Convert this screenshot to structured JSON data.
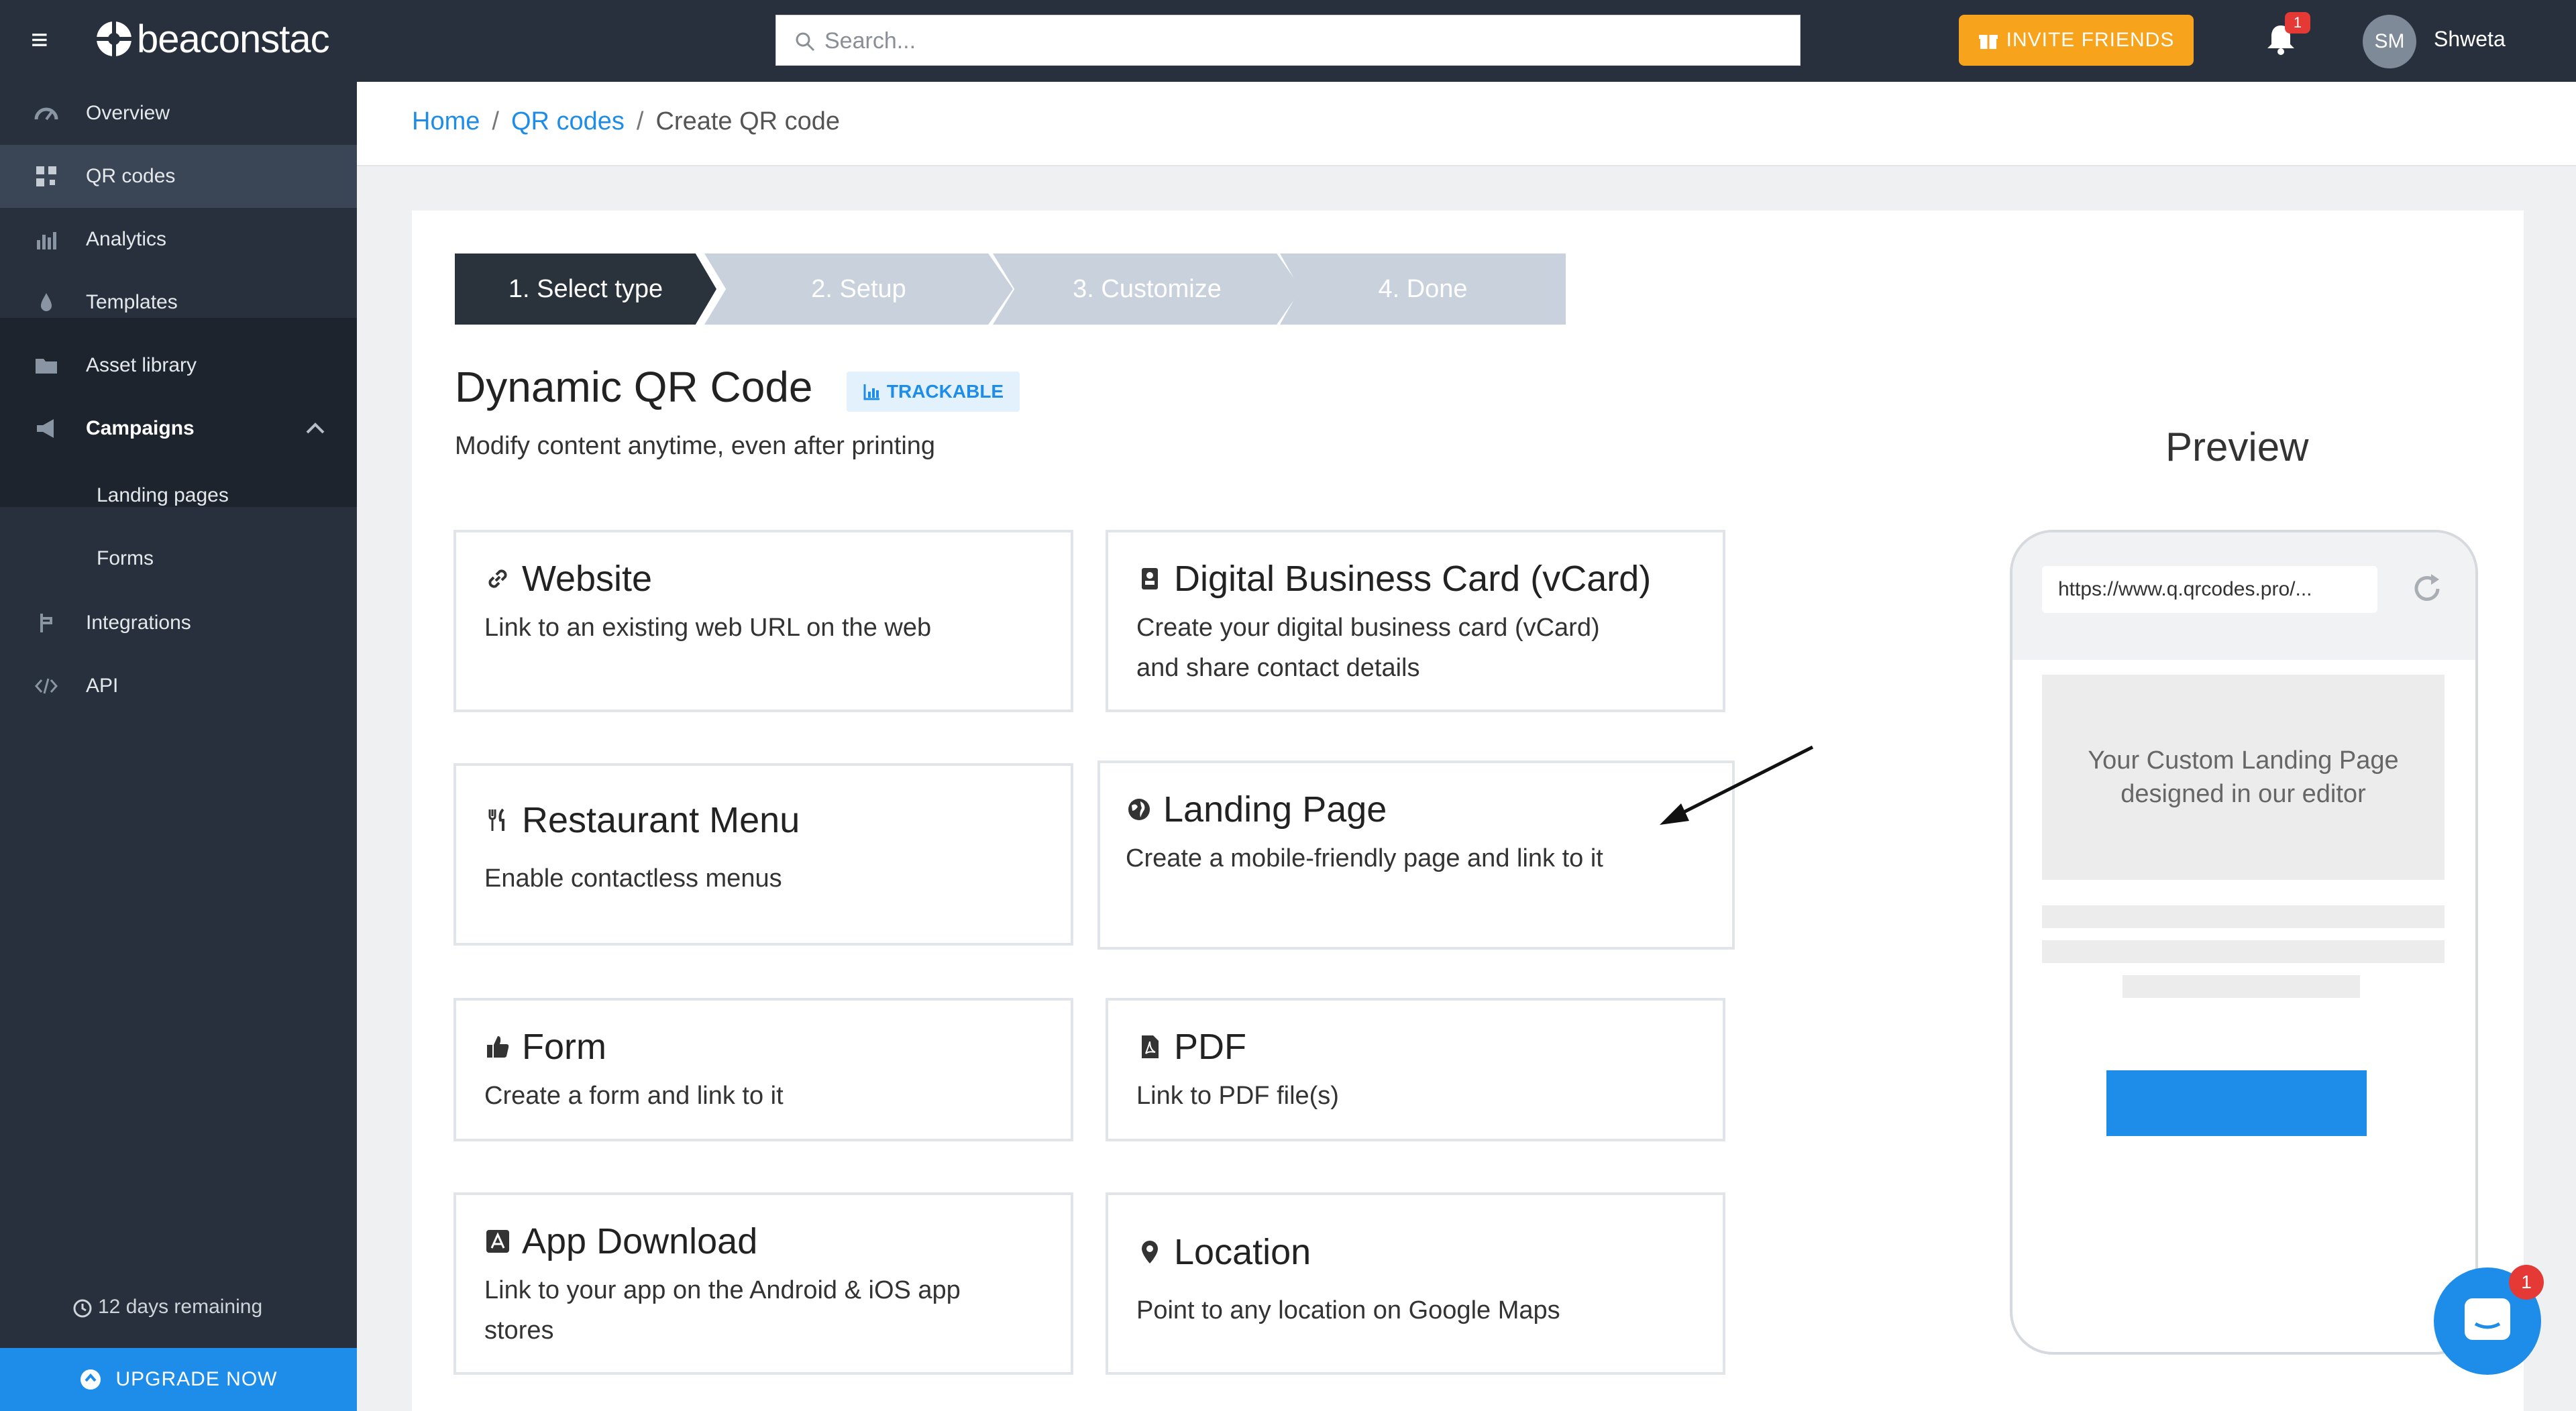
{
  "topbar": {
    "brand": "beaconstac",
    "search_placeholder": "Search...",
    "invite_label": "INVITE FRIENDS",
    "notification_count": "1",
    "avatar_initials": "SM",
    "username": "Shweta"
  },
  "sidebar": {
    "items": [
      {
        "label": "Overview",
        "icon": "speedometer-icon"
      },
      {
        "label": "QR codes",
        "icon": "qr-icon",
        "active": true
      },
      {
        "label": "Analytics",
        "icon": "bar-chart-icon"
      },
      {
        "label": "Templates",
        "icon": "drop-icon"
      },
      {
        "label": "Asset library",
        "icon": "folder-icon"
      },
      {
        "label": "Campaigns",
        "icon": "megaphone-icon",
        "expanded": true
      },
      {
        "label": "Landing pages",
        "sub": true
      },
      {
        "label": "Forms",
        "sub": true
      },
      {
        "label": "Integrations",
        "icon": "integration-icon"
      },
      {
        "label": "API",
        "icon": "code-icon"
      }
    ],
    "trial_text": "12 days remaining",
    "upgrade_label": "UPGRADE NOW"
  },
  "breadcrumb": {
    "home": "Home",
    "qr_codes": "QR codes",
    "current": "Create QR code",
    "separator": "/"
  },
  "stepper": {
    "steps": [
      "1. Select type",
      "2. Setup",
      "3. Customize",
      "4. Done"
    ],
    "active_index": 0
  },
  "heading": {
    "title": "Dynamic QR Code",
    "badge": "TRACKABLE",
    "subtitle": "Modify content anytime, even after printing"
  },
  "options": [
    {
      "title": "Website",
      "desc": "Link to an existing web URL on the web",
      "icon": "link-icon"
    },
    {
      "title": "Digital Business Card (vCard)",
      "desc": "Create your digital business card (vCard) and share contact details",
      "icon": "contact-card-icon"
    },
    {
      "title": "Restaurant Menu",
      "desc": "Enable contactless menus",
      "icon": "cutlery-icon"
    },
    {
      "title": "Landing Page",
      "desc": "Create a mobile-friendly page and link to it",
      "icon": "globe-icon"
    },
    {
      "title": "Form",
      "desc": "Create a form and link to it",
      "icon": "thumbs-up-icon"
    },
    {
      "title": "PDF",
      "desc": "Link to PDF file(s)",
      "icon": "pdf-icon"
    },
    {
      "title": "App Download",
      "desc": "Link to your app on the Android & iOS app stores",
      "icon": "app-store-icon"
    },
    {
      "title": "Location",
      "desc": "Point to any location on Google Maps",
      "icon": "location-pin-icon"
    }
  ],
  "preview": {
    "title": "Preview",
    "url": "https://www.q.qrcodes.pro/...",
    "hero_text": "Your Custom Landing Page designed in our editor"
  },
  "chat": {
    "badge": "1"
  },
  "colors": {
    "accent": "#1e8de9",
    "sidebar": "#27303c",
    "invite": "#f7a31c"
  }
}
